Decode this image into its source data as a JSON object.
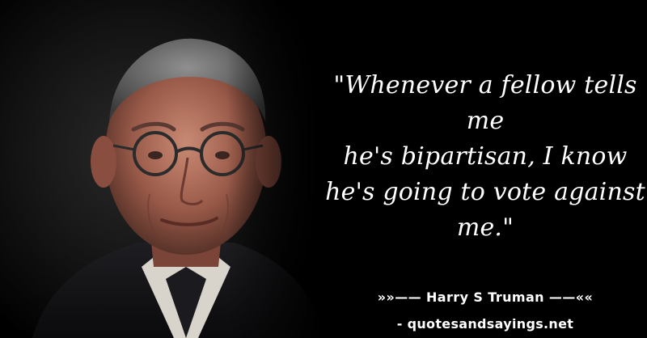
{
  "quote": {
    "lines": [
      "\"Whenever a fellow tells me",
      "he's bipartisan, I know",
      "he's going to vote against",
      "me.\""
    ]
  },
  "attribution": {
    "text": "»»—— Harry S Truman ——««"
  },
  "source": {
    "text": "- quotesandsayings.net"
  },
  "colors": {
    "background": "#000000",
    "text": "#ffffff"
  }
}
